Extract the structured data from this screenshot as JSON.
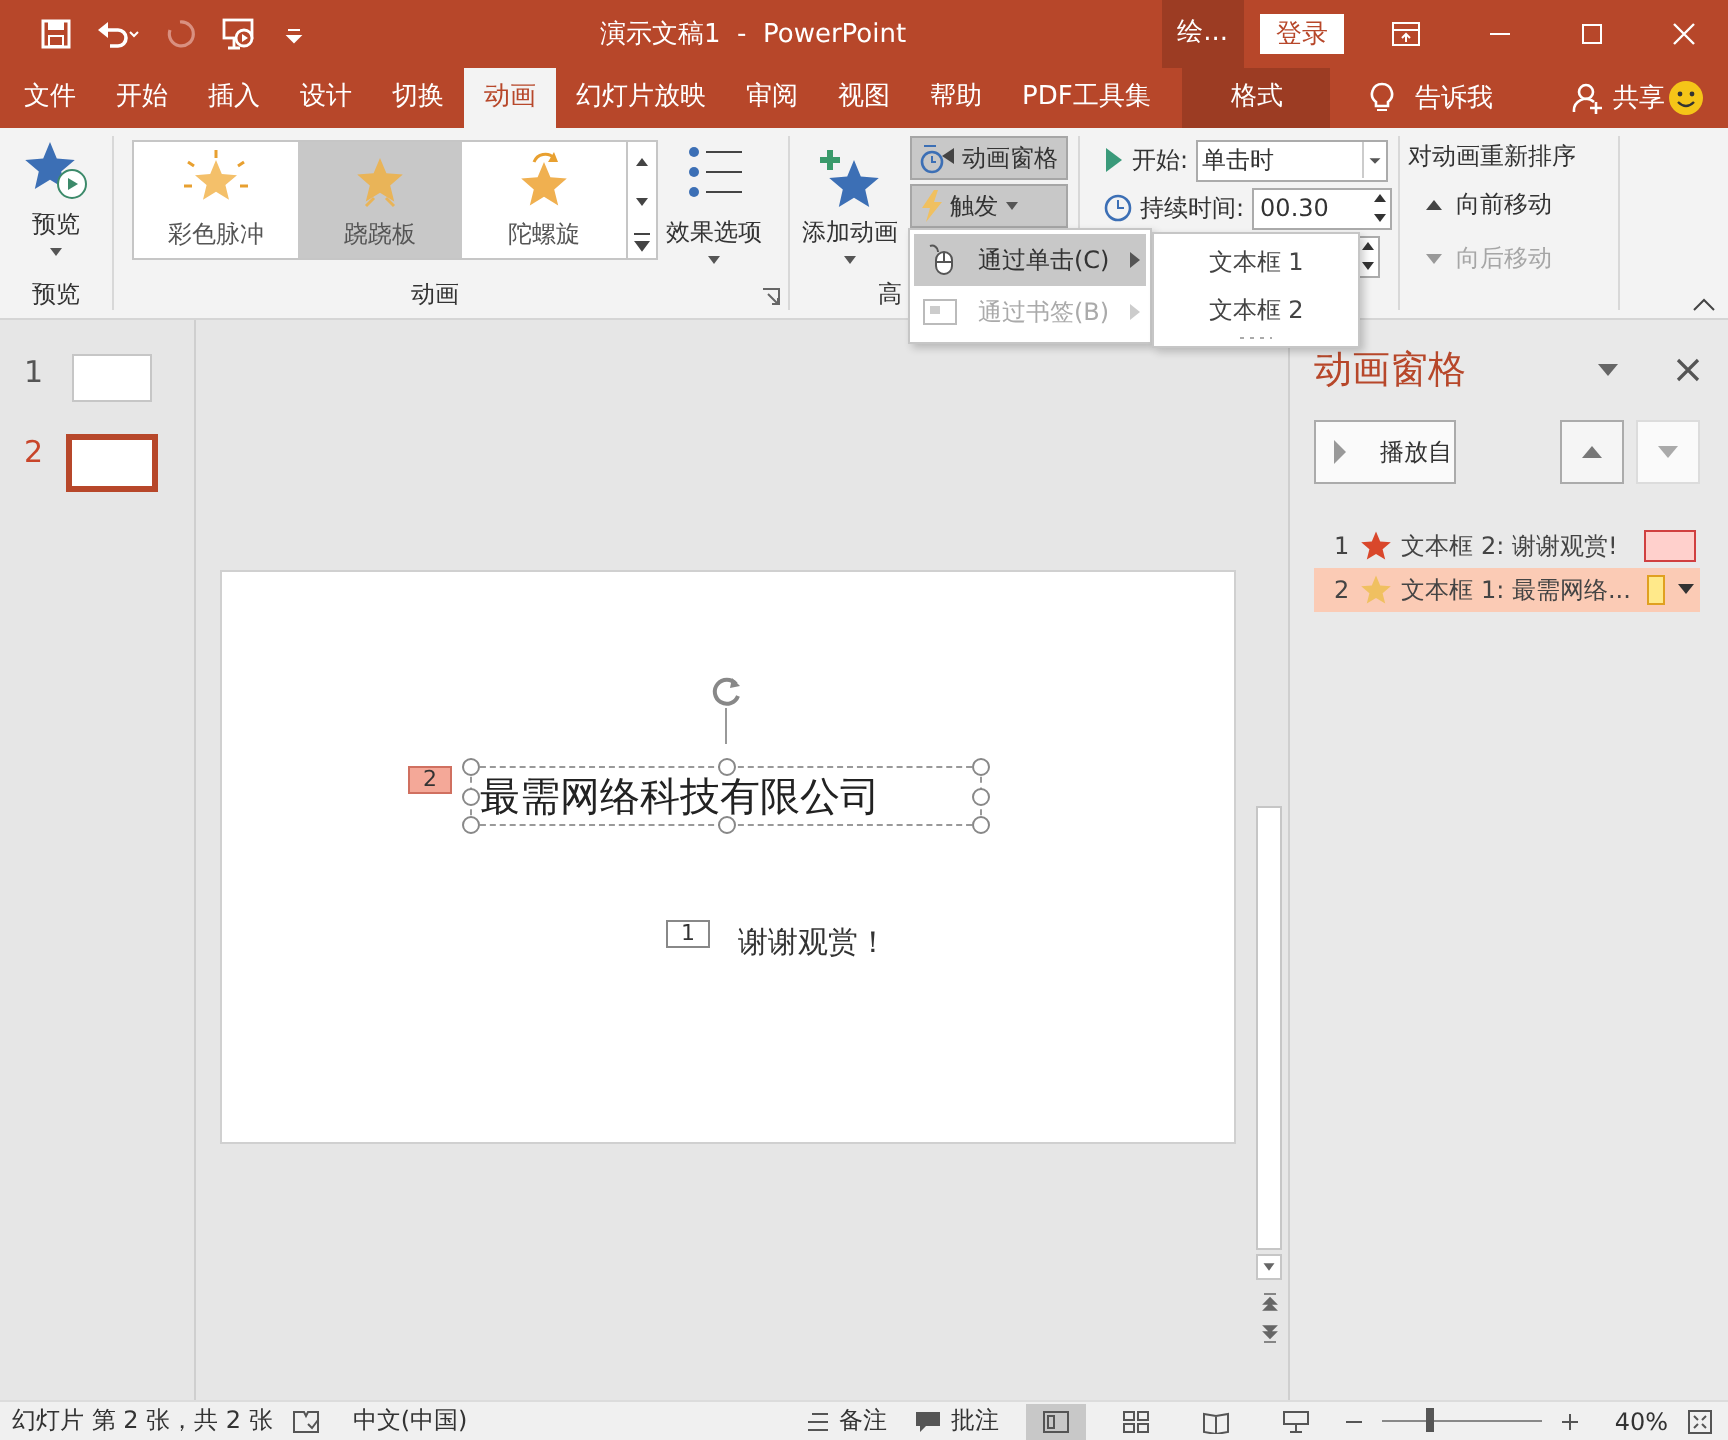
{
  "window": {
    "title": "演示文稿1  -  PowerPoint",
    "context_label": "绘...",
    "login": "登录"
  },
  "tabs": [
    {
      "label": "文件",
      "selected": false,
      "kind": "normal"
    },
    {
      "label": "开始",
      "selected": false,
      "kind": "normal"
    },
    {
      "label": "插入",
      "selected": false,
      "kind": "normal"
    },
    {
      "label": "设计",
      "selected": false,
      "kind": "normal"
    },
    {
      "label": "切换",
      "selected": false,
      "kind": "normal"
    },
    {
      "label": "动画",
      "selected": true,
      "kind": "normal"
    },
    {
      "label": "幻灯片放映",
      "selected": false,
      "kind": "normal"
    },
    {
      "label": "审阅",
      "selected": false,
      "kind": "normal"
    },
    {
      "label": "视图",
      "selected": false,
      "kind": "normal"
    },
    {
      "label": "帮助",
      "selected": false,
      "kind": "normal"
    },
    {
      "label": "PDF工具集",
      "selected": false,
      "kind": "normal"
    },
    {
      "label": "格式",
      "selected": false,
      "kind": "contextual"
    }
  ],
  "tell_me": "告诉我",
  "share": "共享",
  "ribbon": {
    "preview": {
      "button": "预览",
      "group": "预览"
    },
    "gallery": [
      {
        "label": "彩色脉冲",
        "selected": false
      },
      {
        "label": "跷跷板",
        "selected": true
      },
      {
        "label": "陀螺旋",
        "selected": false
      }
    ],
    "effect_options": "效果选项",
    "animation_group": "动画",
    "add_animation": "添加动画",
    "animation_pane": "动画窗格",
    "trigger": "触发",
    "advanced_group": "高",
    "start_label": "开始:",
    "start_value": "单击时",
    "duration_label": "持续时间:",
    "duration_value": "00.30",
    "reorder_title": "对动画重新排序",
    "move_earlier": {
      "label": "向前移动",
      "disabled": false
    },
    "move_later": {
      "label": "向后移动",
      "disabled": true
    }
  },
  "trigger_menu": {
    "items": [
      {
        "label": "通过单击(C)",
        "selected": true,
        "disabled": false
      },
      {
        "label": "通过书签(B)",
        "selected": false,
        "disabled": true
      }
    ],
    "submenu": [
      "文本框 1",
      "文本框 2"
    ]
  },
  "thumbnails": [
    {
      "number": "1",
      "selected": false
    },
    {
      "number": "2",
      "selected": true
    }
  ],
  "slide": {
    "title": {
      "text": "最需网络科技有限公司",
      "tag": "2"
    },
    "body": {
      "text": "谢谢观赏！",
      "tag": "1"
    }
  },
  "animation_pane": {
    "title": "动画窗格",
    "play_from": "播放自",
    "items": [
      {
        "number": "1",
        "label": "文本框 2: 谢谢观赏!",
        "selected": false,
        "color": "#d9472b"
      },
      {
        "number": "2",
        "label": "文本框 1: 最需网络...",
        "selected": true,
        "color": "#f0c060"
      }
    ]
  },
  "status_bar": {
    "slide_info": "幻灯片 第 2 张，共 2 张",
    "language": "中文(中国)",
    "notes": "备注",
    "comments": "批注",
    "views": [
      {
        "selected": true
      },
      {
        "selected": false
      },
      {
        "selected": false
      },
      {
        "selected": false
      }
    ],
    "zoom_slider": {
      "level": 0.3
    },
    "zoom": "40%"
  }
}
